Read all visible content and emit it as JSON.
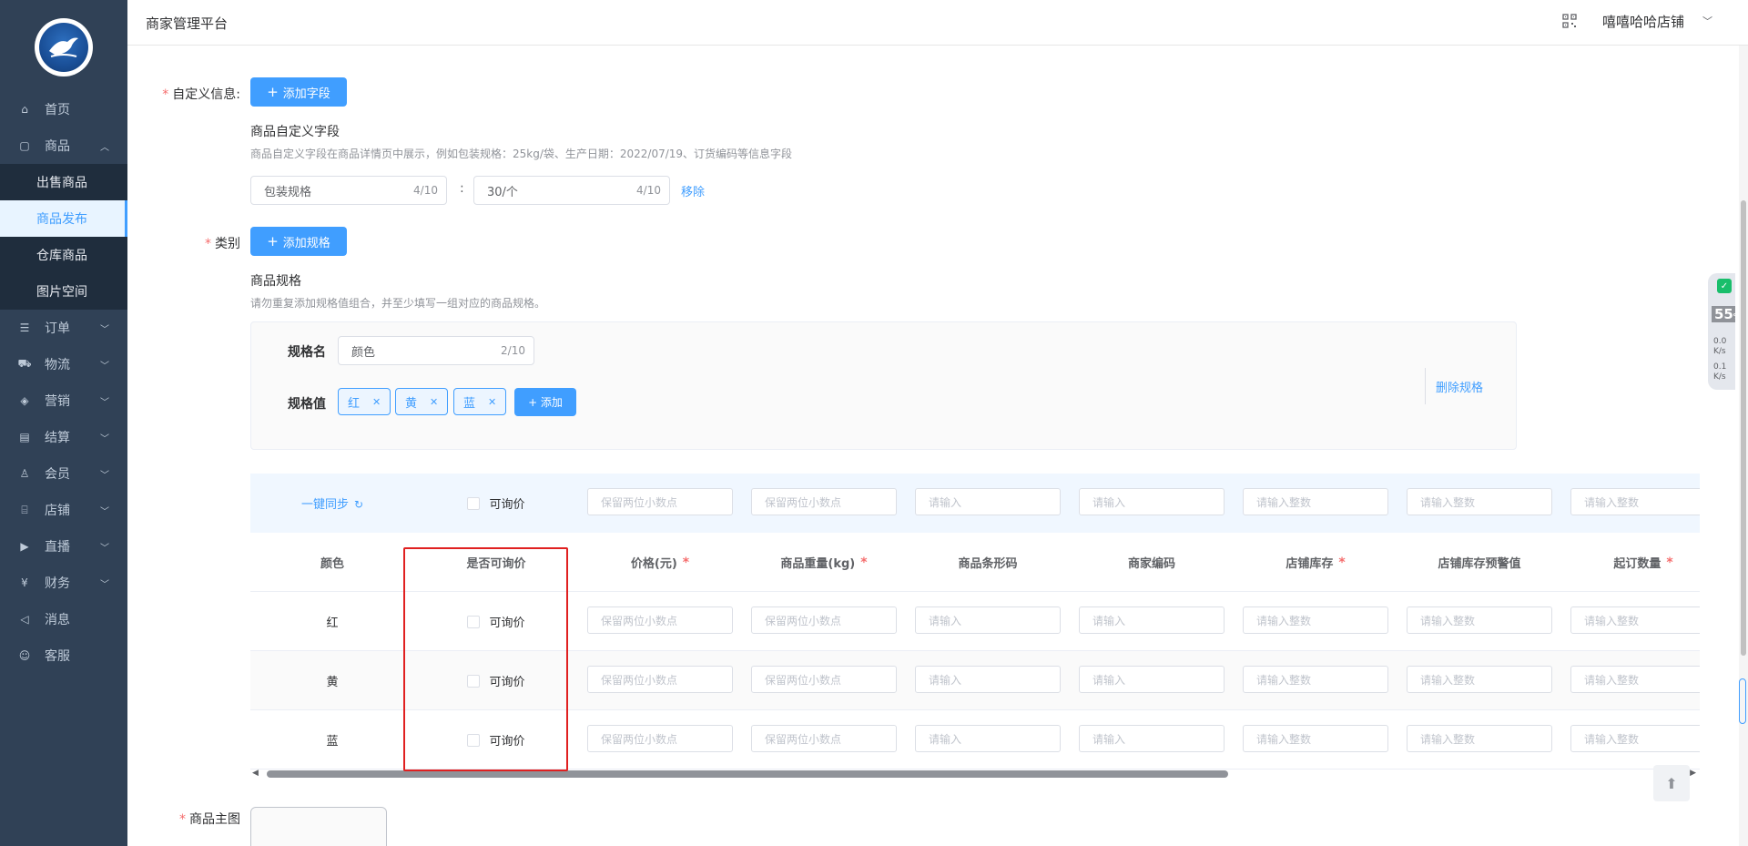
{
  "header": {
    "title": "商家管理平台",
    "shop_name": "嘻嘻哈哈店铺"
  },
  "sidebar": {
    "items": [
      {
        "label": "首页",
        "icon": "home-icon"
      },
      {
        "label": "商品",
        "icon": "goods-icon",
        "expanded": true,
        "children": [
          {
            "label": "出售商品"
          },
          {
            "label": "商品发布",
            "active": true
          },
          {
            "label": "仓库商品"
          },
          {
            "label": "图片空间"
          }
        ]
      },
      {
        "label": "订单",
        "icon": "order-icon"
      },
      {
        "label": "物流",
        "icon": "truck-icon"
      },
      {
        "label": "营销",
        "icon": "tag-icon"
      },
      {
        "label": "结算",
        "icon": "ledger-icon"
      },
      {
        "label": "会员",
        "icon": "user-icon"
      },
      {
        "label": "店铺",
        "icon": "store-icon"
      },
      {
        "label": "直播",
        "icon": "live-icon"
      },
      {
        "label": "财务",
        "icon": "finance-icon"
      },
      {
        "label": "消息",
        "icon": "speaker-icon"
      },
      {
        "label": "客服",
        "icon": "service-icon"
      }
    ]
  },
  "custom_info": {
    "label": "自定义信息:",
    "add_button": "添加字段",
    "section_title": "商品自定义字段",
    "hint": "商品自定义字段在商品详情页中展示，例如包装规格：25kg/袋、生产日期：2022/07/19、订货编码等信息字段",
    "field_name": {
      "value": "包装规格",
      "count": "4/10"
    },
    "colon": ":",
    "field_value": {
      "value": "30/个",
      "count": "4/10"
    },
    "remove": "移除"
  },
  "category": {
    "label": "类别",
    "add_button": "添加规格",
    "section_title": "商品规格",
    "hint": "请勿重复添加规格值组合，并至少填写一组对应的商品规格。",
    "spec_name_label": "规格名",
    "spec_name": {
      "value": "颜色",
      "count": "2/10"
    },
    "spec_values_label": "规格值",
    "spec_values": [
      "红",
      "黄",
      "蓝"
    ],
    "add_value_button": "+ 添加",
    "delete_spec": "删除规格"
  },
  "sku_table": {
    "sync_label": "一键同步",
    "inquiry_label": "可询价",
    "headers": [
      {
        "label": "颜色",
        "required": false
      },
      {
        "label": "是否可询价",
        "required": false
      },
      {
        "label": "价格(元)",
        "required": true
      },
      {
        "label": "商品重量(kg)",
        "required": true
      },
      {
        "label": "商品条形码",
        "required": false
      },
      {
        "label": "商家编码",
        "required": false
      },
      {
        "label": "店铺库存",
        "required": true
      },
      {
        "label": "店铺库存预警值",
        "required": false
      },
      {
        "label": "起订数量",
        "required": true
      }
    ],
    "placeholders": [
      "保留两位小数点",
      "保留两位小数点",
      "请输入",
      "请输入",
      "请输入整数",
      "请输入整数",
      "请输入整数"
    ],
    "rows": [
      {
        "color": "红"
      },
      {
        "color": "黄"
      },
      {
        "color": "蓝"
      }
    ]
  },
  "main_image": {
    "label": "商品主图"
  },
  "widget": {
    "percent": "55",
    "percent_unit": "%",
    "up": "0.0",
    "down": "0.1",
    "unit": "K/s"
  }
}
